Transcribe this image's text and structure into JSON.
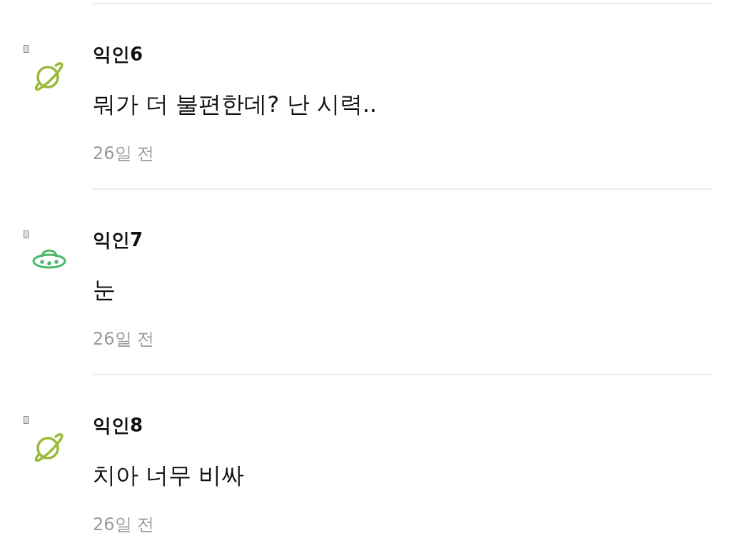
{
  "comments": [
    {
      "author": "익인6",
      "text": "뭐가 더 불편한데? 난 시력..",
      "time": "26일 전",
      "avatar": {
        "kind": "planet",
        "color": "#9aba3c"
      }
    },
    {
      "author": "익인7",
      "text": "눈",
      "time": "26일 전",
      "avatar": {
        "kind": "ufo",
        "color": "#4cb86a"
      }
    },
    {
      "author": "익인8",
      "text": "치아 너무 비싸",
      "time": "26일 전",
      "avatar": {
        "kind": "planet",
        "color": "#9aba3c"
      }
    }
  ]
}
